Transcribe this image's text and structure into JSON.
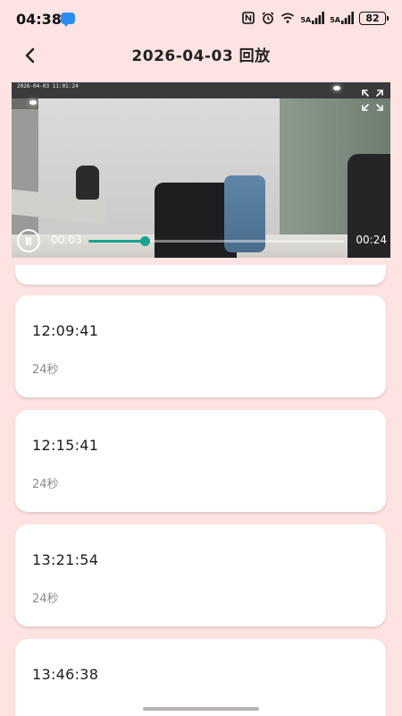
{
  "status_bar": {
    "time": "04:38",
    "battery": "82",
    "net1": "5A",
    "net2": "5A"
  },
  "header": {
    "title": "2026-04-03 回放"
  },
  "player": {
    "timestamp": "2026-04-03 11:01:24",
    "current_time": "00:03",
    "total_time": "00:24",
    "progress": 0.22
  },
  "records": [
    {
      "time": "",
      "duration": ""
    },
    {
      "time": "12:09:41",
      "duration": "24秒"
    },
    {
      "time": "12:15:41",
      "duration": "24秒"
    },
    {
      "time": "13:21:54",
      "duration": "24秒"
    },
    {
      "time": "13:46:38",
      "duration": ""
    }
  ],
  "colors": {
    "background": "#fde3e1",
    "accent": "#1aa38f"
  }
}
